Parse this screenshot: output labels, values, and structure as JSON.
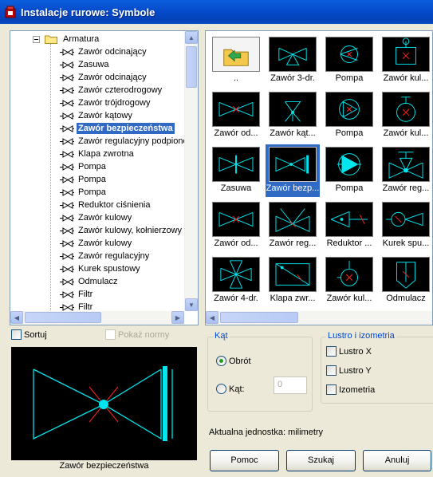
{
  "window": {
    "title": "Instalacje rurowe: Symbole"
  },
  "tree": {
    "root_label": "Armatura",
    "items": [
      {
        "label": "Zawór odcinający"
      },
      {
        "label": "Zasuwa"
      },
      {
        "label": "Zawór odcinający"
      },
      {
        "label": "Zawór czterodrogowy"
      },
      {
        "label": "Zawór trójdrogowy"
      },
      {
        "label": "Zawór kątowy"
      },
      {
        "label": "Zawór bezpieczeństwa",
        "selected": true
      },
      {
        "label": "Zawór regulacyjny podpionowy"
      },
      {
        "label": "Klapa zwrotna"
      },
      {
        "label": "Pompa"
      },
      {
        "label": "Pompa"
      },
      {
        "label": "Pompa"
      },
      {
        "label": "Reduktor ciśnienia"
      },
      {
        "label": "Zawór kulowy"
      },
      {
        "label": "Zawór kulowy, kołnierzowy"
      },
      {
        "label": "Zawór kulowy"
      },
      {
        "label": "Zawór regulacyjny"
      },
      {
        "label": "Kurek spustowy"
      },
      {
        "label": "Odmulacz"
      },
      {
        "label": "Filtr"
      },
      {
        "label": "Filtr"
      }
    ]
  },
  "grid": {
    "tiles": [
      {
        "label": "..",
        "icon": "folder-up-icon"
      },
      {
        "label": "Zawór 3-dr.",
        "icon": "three-way-valve-icon"
      },
      {
        "label": "Pompa",
        "icon": "pump-cross-icon"
      },
      {
        "label": "Zawór kul...",
        "icon": "ball-valve-flag-icon"
      },
      {
        "label": "Zawór od...",
        "icon": "shutoff-valve-icon"
      },
      {
        "label": "Zawór kąt...",
        "icon": "angle-valve-icon"
      },
      {
        "label": "Pompa",
        "icon": "pump-triangle-icon"
      },
      {
        "label": "Zawór kul...",
        "icon": "ball-valve-circle-icon"
      },
      {
        "label": "Zasuwa",
        "icon": "gate-valve-icon"
      },
      {
        "label": "Zawór bezp...",
        "icon": "safety-valve-icon",
        "selected": true
      },
      {
        "label": "Pompa",
        "icon": "pump-filled-icon"
      },
      {
        "label": "Zawór reg...",
        "icon": "control-valve-icon"
      },
      {
        "label": "Zawór od...",
        "icon": "shutoff-valve-icon"
      },
      {
        "label": "Zawór reg...",
        "icon": "control-valve-x-icon"
      },
      {
        "label": "Reduktor ...",
        "icon": "pressure-reducer-icon"
      },
      {
        "label": "Kurek spu...",
        "icon": "drain-cock-icon"
      },
      {
        "label": "Zawór 4-dr.",
        "icon": "four-way-valve-icon"
      },
      {
        "label": "Klapa zwr...",
        "icon": "check-valve-icon"
      },
      {
        "label": "Zawór kul...",
        "icon": "ball-valve-stem-icon"
      },
      {
        "label": "Odmulacz",
        "icon": "sludge-separator-icon"
      }
    ]
  },
  "options": {
    "sort_label": "Sortuj",
    "show_norms_label": "Pokaż normy"
  },
  "preview": {
    "caption": "Zawór bezpieczeństwa"
  },
  "angle": {
    "group_title": "Kąt",
    "rotation_label": "Obrót",
    "angle_label": "Kąt:",
    "angle_value": "0"
  },
  "mirror": {
    "group_title": "Lustro i izometria",
    "mirror_x_label": "Lustro X",
    "mirror_y_label": "Lustro Y",
    "isometric_label": "Izometria"
  },
  "units_text": "Aktualna jednostka: milimetry",
  "buttons": {
    "help": "Pomoc",
    "search": "Szukaj",
    "cancel": "Anuluj"
  },
  "colors": {
    "symbol": "#00e5ee",
    "accent": "#ff2020",
    "selection": "#316ac5"
  }
}
